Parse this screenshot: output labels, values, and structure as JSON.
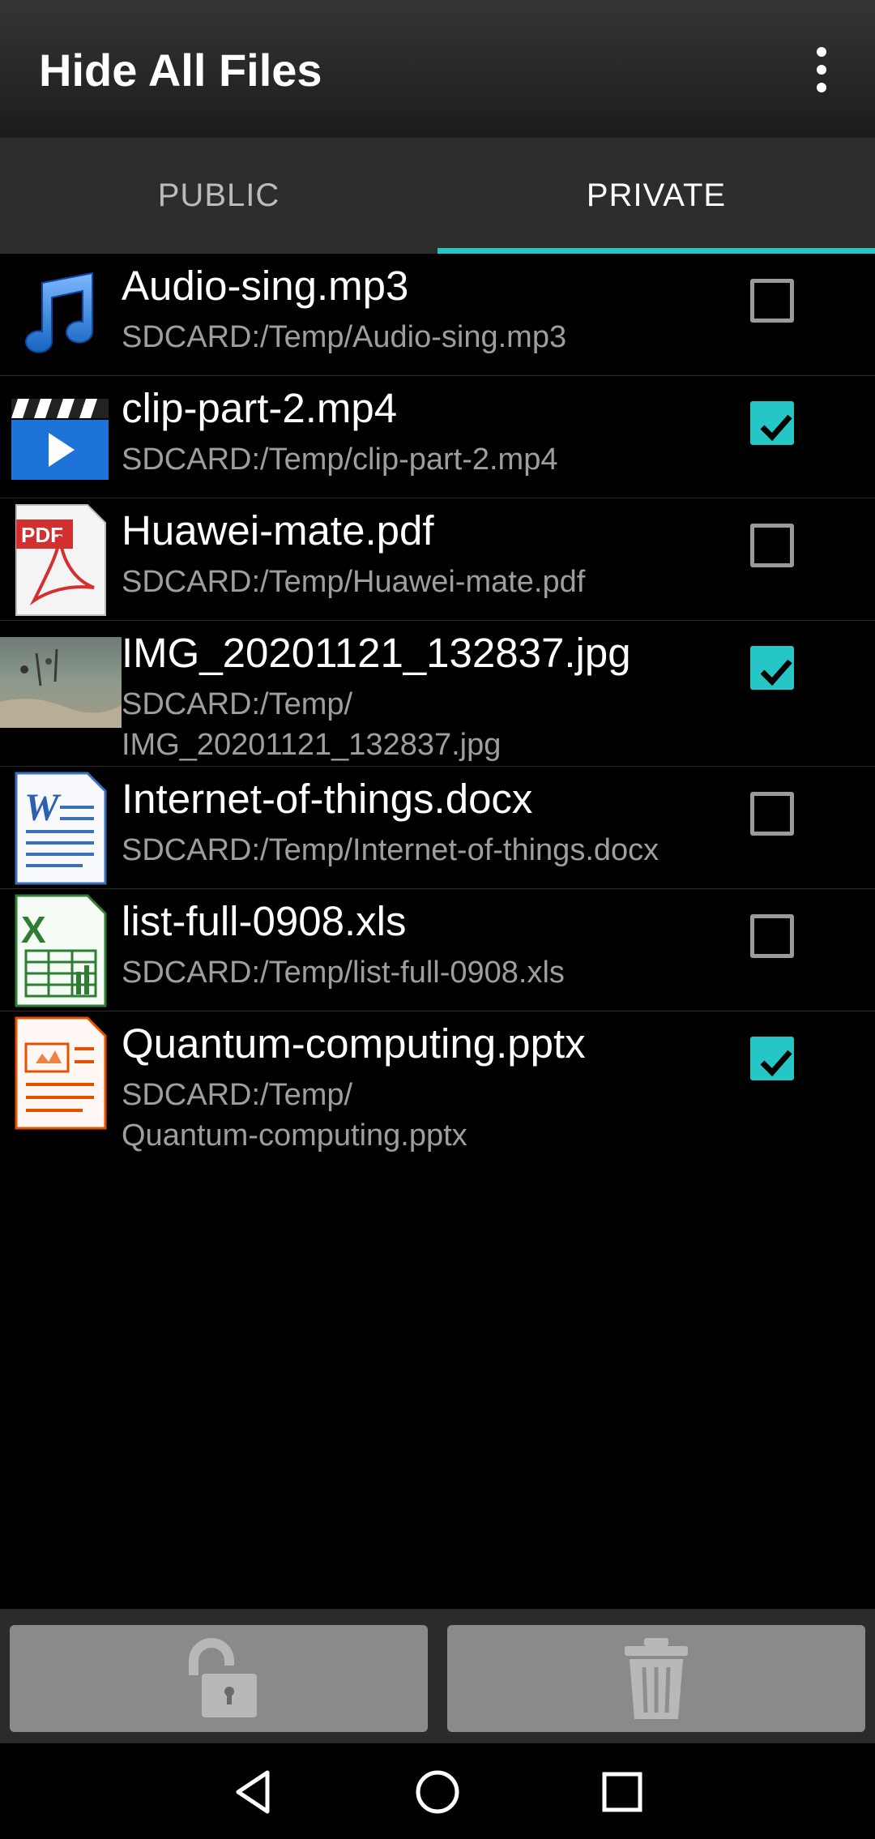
{
  "app": {
    "title": "Hide All Files"
  },
  "tabs": [
    {
      "label": "PUBLIC",
      "active": false
    },
    {
      "label": "PRIVATE",
      "active": true
    }
  ],
  "files": [
    {
      "name": "Audio-sing.mp3",
      "path": "SDCARD:/Temp/Audio-sing.mp3",
      "checked": false,
      "icon": "music-note-icon"
    },
    {
      "name": "clip-part-2.mp4",
      "path": "SDCARD:/Temp/clip-part-2.mp4",
      "checked": true,
      "icon": "video-clapper-icon"
    },
    {
      "name": "Huawei-mate.pdf",
      "path": "SDCARD:/Temp/Huawei-mate.pdf",
      "checked": false,
      "icon": "pdf-file-icon"
    },
    {
      "name": "IMG_20201121_132837.jpg",
      "path": "SDCARD:/Temp/\nIMG_20201121_132837.jpg",
      "checked": true,
      "icon": "image-thumbnail"
    },
    {
      "name": "Internet-of-things.docx",
      "path": "SDCARD:/Temp/Internet-of-things.docx",
      "checked": false,
      "icon": "word-doc-icon"
    },
    {
      "name": "list-full-0908.xls",
      "path": "SDCARD:/Temp/list-full-0908.xls",
      "checked": false,
      "icon": "excel-sheet-icon"
    },
    {
      "name": "Quantum-computing.pptx",
      "path": "SDCARD:/Temp/\nQuantum-computing.pptx",
      "checked": true,
      "icon": "powerpoint-icon"
    }
  ],
  "bottom_bar": {
    "unlock_icon": "unlock-icon",
    "delete_icon": "trash-icon"
  },
  "colors": {
    "accent": "#26c6c6",
    "button_bg": "#8a8a8a"
  }
}
